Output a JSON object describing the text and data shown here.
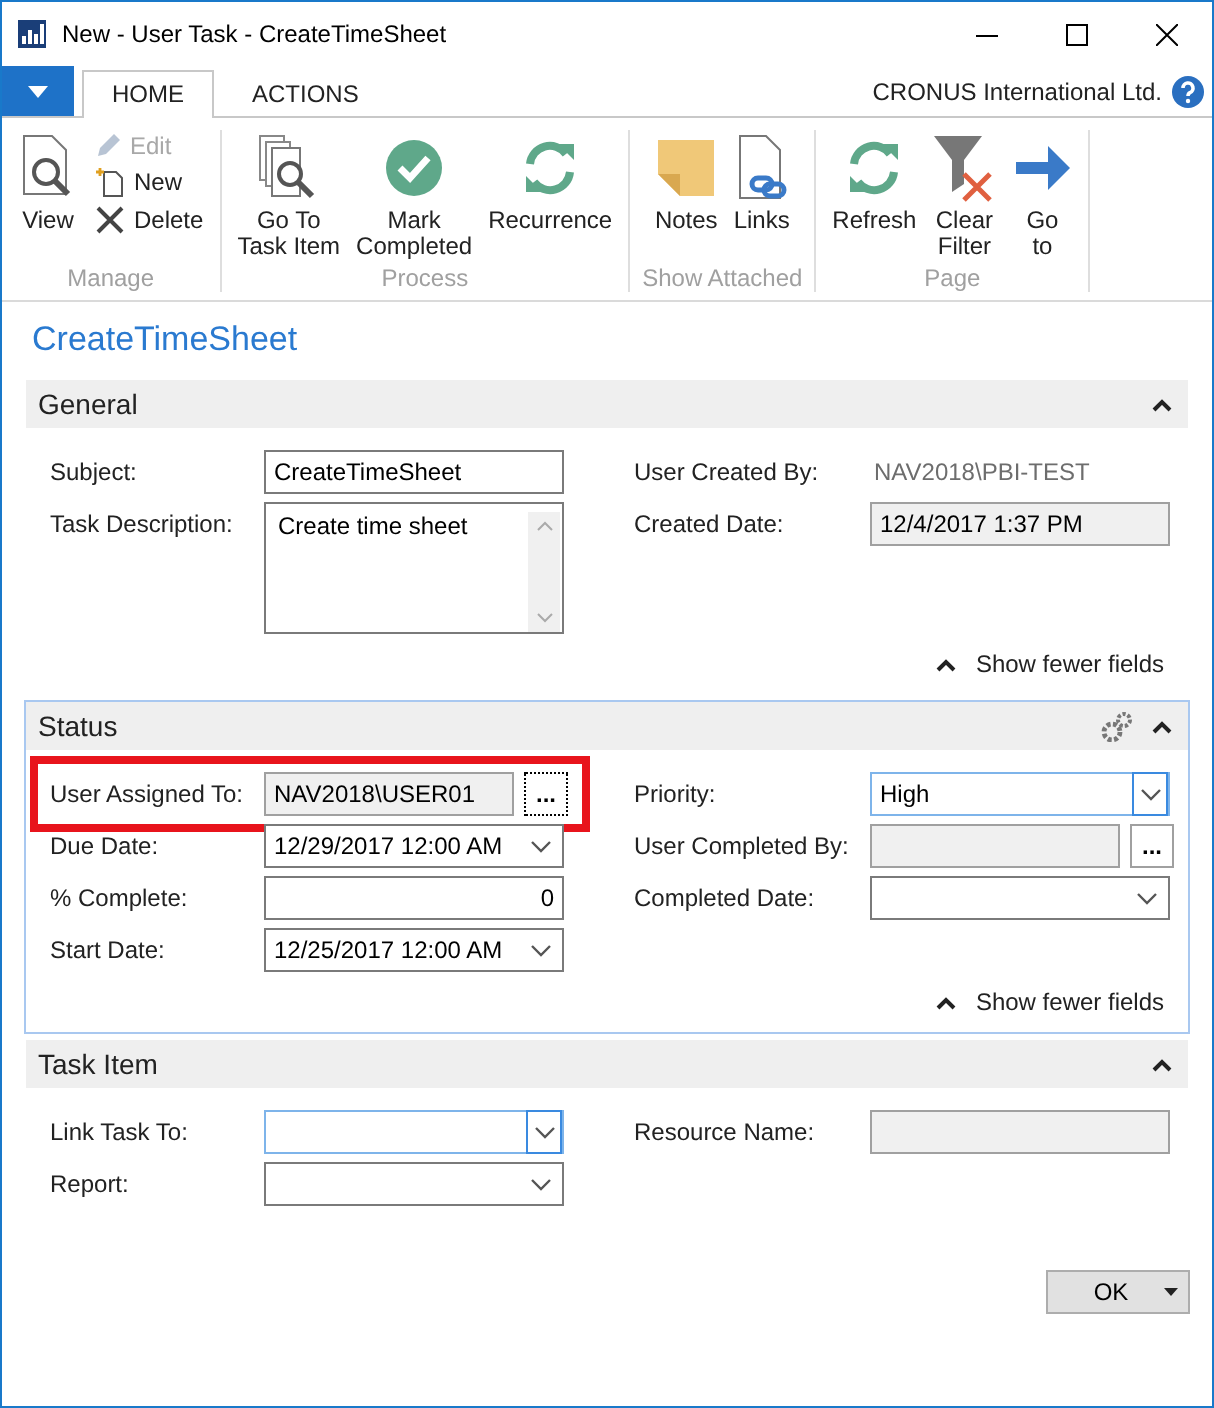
{
  "window": {
    "title": "New - User Task - CreateTimeSheet"
  },
  "tabs": [
    {
      "label": "HOME",
      "selected": true
    },
    {
      "label": "ACTIONS",
      "selected": false
    }
  ],
  "company": "CRONUS International Ltd.",
  "ribbon": {
    "groups": [
      {
        "label": "Manage",
        "buttons": [
          {
            "label": "View",
            "kind": "view",
            "disabled": false
          },
          {
            "label": "Edit",
            "kind": "edit",
            "disabled": true
          },
          {
            "label": "New",
            "kind": "new",
            "disabled": false
          },
          {
            "label": "Delete",
            "kind": "delete",
            "disabled": false
          }
        ]
      },
      {
        "label": "Process",
        "buttons": [
          {
            "label": "Go To\nTask Item",
            "kind": "docs",
            "disabled": false
          },
          {
            "label": "Mark\nCompleted",
            "kind": "check",
            "disabled": false
          },
          {
            "label": "Recurrence",
            "kind": "cycle",
            "disabled": false
          }
        ]
      },
      {
        "label": "Show Attached",
        "buttons": [
          {
            "label": "Notes",
            "kind": "note",
            "disabled": false
          },
          {
            "label": "Links",
            "kind": "link",
            "disabled": false
          }
        ]
      },
      {
        "label": "Page",
        "buttons": [
          {
            "label": "Refresh",
            "kind": "cycle",
            "disabled": false
          },
          {
            "label": "Clear\nFilter",
            "kind": "filter",
            "disabled": false
          },
          {
            "label": "Go\nto",
            "kind": "arrow",
            "disabled": false
          }
        ]
      }
    ]
  },
  "page_title": "CreateTimeSheet",
  "sections": [
    {
      "title": "General",
      "expanded": true,
      "selected": false,
      "footer": "Show fewer fields",
      "fields_left": [
        {
          "label": "Subject:",
          "kind": "text",
          "value": "CreateTimeSheet"
        },
        {
          "label": "Task Description:",
          "kind": "textarea",
          "value": "Create time sheet"
        }
      ],
      "fields_right": [
        {
          "label": "User Created By:",
          "kind": "readonly",
          "value": "NAV2018\\PBI-TEST"
        },
        {
          "label": "Created Date:",
          "kind": "disabled",
          "value": "12/4/2017 1:37 PM"
        }
      ]
    },
    {
      "title": "Status",
      "expanded": true,
      "selected": true,
      "show_settings": true,
      "footer": "Show fewer fields",
      "fields_left": [
        {
          "label": "User Assigned To:",
          "kind": "lookup",
          "value": "NAV2018\\USER01",
          "button": "...",
          "highlighted": true
        },
        {
          "label": "Due Date:",
          "kind": "dropdown",
          "value": "12/29/2017 12:00 AM"
        },
        {
          "label": "% Complete:",
          "kind": "number",
          "value": "0"
        },
        {
          "label": "Start Date:",
          "kind": "dropdown",
          "value": "12/25/2017 12:00 AM"
        }
      ],
      "fields_right": [
        {
          "label": "Priority:",
          "kind": "dropdown",
          "value": "High",
          "focused": true
        },
        {
          "label": "User Completed By:",
          "kind": "lookup",
          "button": "..."
        },
        {
          "label": "Completed Date:",
          "kind": "dropdown"
        }
      ]
    },
    {
      "title": "Task Item",
      "expanded": true,
      "selected": false,
      "fields_left": [
        {
          "label": "Link Task To:",
          "kind": "dropdown",
          "focused": true
        },
        {
          "label": "Report:",
          "kind": "dropdown"
        }
      ],
      "fields_right": [
        {
          "label": "Resource Name:",
          "kind": "disabled"
        }
      ]
    }
  ],
  "ok_button": "OK"
}
